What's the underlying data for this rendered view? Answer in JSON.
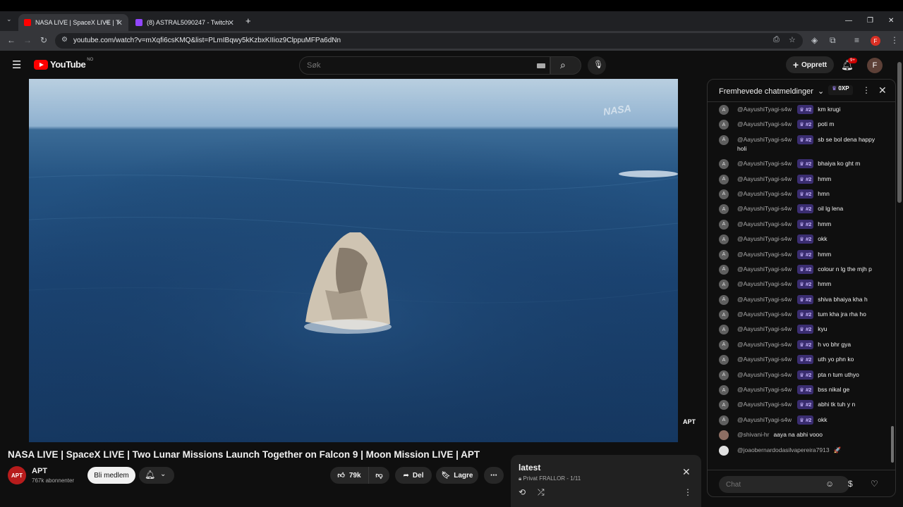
{
  "browser": {
    "tabs": [
      {
        "title": "NASA LIVE | SpaceX LIVE | T",
        "active": true
      },
      {
        "title": "(8) ASTRAL5090247 - Twitch",
        "active": false
      }
    ],
    "url": "youtube.com/watch?v=mXqfi6csKMQ&list=PLmIBqwy5kKzbxKIIioz9ClppuMFPa6dNn",
    "profile_initial": "F"
  },
  "youtube": {
    "logo_text": "YouTube",
    "country_code": "NO",
    "search_placeholder": "Søk",
    "create_label": "Opprett",
    "notification_count": "9+",
    "avatar_initial": "F"
  },
  "video": {
    "title": "NASA LIVE | SpaceX LIVE | Two Lunar Missions Launch Together on Falcon 9 | Moon Mission LIVE | APT",
    "nasa_watermark": "NASA",
    "apt_watermark": "APT",
    "channel": {
      "name": "APT",
      "subscribers": "767k abonnenter",
      "avatar_text": "APT"
    },
    "join_label": "Bli medlem",
    "like_count": "79k",
    "share_label": "Del",
    "save_label": "Lagre"
  },
  "playlist": {
    "title": "latest",
    "privacy": "Privat",
    "owner_position": "FRALLOR - 1/11"
  },
  "chat": {
    "header_title": "Fremhevede chatmeldinger",
    "xp_label": "0XP",
    "input_placeholder": "Chat",
    "messages": [
      {
        "avatar": "A",
        "author": "@AayushiTyagi-s4w",
        "badge": "#2",
        "text": "km krugi"
      },
      {
        "avatar": "A",
        "author": "@AayushiTyagi-s4w",
        "badge": "#2",
        "text": "poti m"
      },
      {
        "avatar": "A",
        "author": "@AayushiTyagi-s4w",
        "badge": "#2",
        "text": "sb se bol dena happy holi"
      },
      {
        "avatar": "A",
        "author": "@AayushiTyagi-s4w",
        "badge": "#2",
        "text": "bhaiya ko ght m"
      },
      {
        "avatar": "A",
        "author": "@AayushiTyagi-s4w",
        "badge": "#2",
        "text": "hmm"
      },
      {
        "avatar": "A",
        "author": "@AayushiTyagi-s4w",
        "badge": "#2",
        "text": "hmn"
      },
      {
        "avatar": "A",
        "author": "@AayushiTyagi-s4w",
        "badge": "#2",
        "text": "oil lg lena"
      },
      {
        "avatar": "A",
        "author": "@AayushiTyagi-s4w",
        "badge": "#2",
        "text": "hmm"
      },
      {
        "avatar": "A",
        "author": "@AayushiTyagi-s4w",
        "badge": "#2",
        "text": "okk"
      },
      {
        "avatar": "A",
        "author": "@AayushiTyagi-s4w",
        "badge": "#2",
        "text": "hmm"
      },
      {
        "avatar": "A",
        "author": "@AayushiTyagi-s4w",
        "badge": "#2",
        "text": "colour n lg the mjh p"
      },
      {
        "avatar": "A",
        "author": "@AayushiTyagi-s4w",
        "badge": "#2",
        "text": "hmm"
      },
      {
        "avatar": "A",
        "author": "@AayushiTyagi-s4w",
        "badge": "#2",
        "text": "shiva bhaiya kha h"
      },
      {
        "avatar": "A",
        "author": "@AayushiTyagi-s4w",
        "badge": "#2",
        "text": "tum kha jra rha ho"
      },
      {
        "avatar": "A",
        "author": "@AayushiTyagi-s4w",
        "badge": "#2",
        "text": "kyu"
      },
      {
        "avatar": "A",
        "author": "@AayushiTyagi-s4w",
        "badge": "#2",
        "text": "h vo bhr gya"
      },
      {
        "avatar": "A",
        "author": "@AayushiTyagi-s4w",
        "badge": "#2",
        "text": "uth yo phn ko"
      },
      {
        "avatar": "A",
        "author": "@AayushiTyagi-s4w",
        "badge": "#2",
        "text": "pta n tum uthyo"
      },
      {
        "avatar": "A",
        "author": "@AayushiTyagi-s4w",
        "badge": "#2",
        "text": "bss nikal ge"
      },
      {
        "avatar": "A",
        "author": "@AayushiTyagi-s4w",
        "badge": "#2",
        "text": "abhi tk tuh y n"
      },
      {
        "avatar": "A",
        "author": "@AayushiTyagi-s4w",
        "badge": "#2",
        "text": "okk"
      },
      {
        "avatar": "",
        "author": "@shivani-hr",
        "badge": "",
        "text": "aaya na abhi vooo"
      },
      {
        "avatar": "",
        "author": "@joaobernardodasilvapereira7913",
        "badge": "",
        "text": "🚀"
      }
    ]
  },
  "colors": {
    "brand_red": "#ff0000",
    "badge_purple": "#3a2d70",
    "bg": "#0f0f0f"
  }
}
